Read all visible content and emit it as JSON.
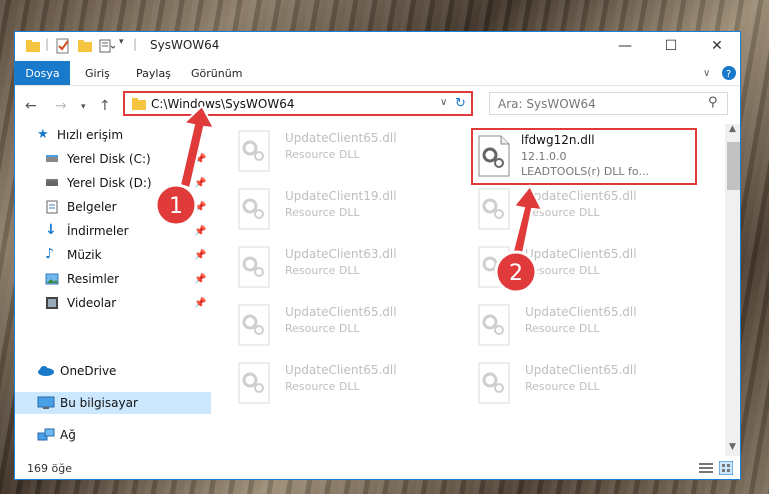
{
  "window": {
    "title": "SysWOW64",
    "controls": {
      "minimize": "—",
      "maximize": "☐",
      "close": "✕"
    }
  },
  "ribbon": {
    "file_tab": "Dosya",
    "tabs": [
      "Giriş",
      "Paylaş",
      "Görünüm"
    ]
  },
  "address": {
    "path": "C:\\Windows\\SysWOW64",
    "search_placeholder": "Ara: SysWOW64"
  },
  "nav": {
    "items": [
      {
        "label": "Hızlı erişim",
        "icon": "star-icon"
      },
      {
        "label": "Yerel Disk (C:)",
        "icon": "drive-icon"
      },
      {
        "label": "Yerel Disk (D:)",
        "icon": "drive-icon"
      },
      {
        "label": "Belgeler",
        "icon": "documents-icon"
      },
      {
        "label": "İndirmeler",
        "icon": "download-icon"
      },
      {
        "label": "Müzik",
        "icon": "music-icon"
      },
      {
        "label": "Resimler",
        "icon": "pictures-icon"
      },
      {
        "label": "Videolar",
        "icon": "videos-icon"
      },
      {
        "label": "OneDrive",
        "icon": "cloud-icon"
      },
      {
        "label": "Bu bilgisayar",
        "icon": "computer-icon"
      },
      {
        "label": "Ağ",
        "icon": "network-icon"
      }
    ]
  },
  "files": {
    "left": [
      {
        "name": "UpdateClient65.dll",
        "desc": "Resource DLL"
      },
      {
        "name": "UpdateClient19.dll",
        "desc": "Resource DLL"
      },
      {
        "name": "UpdateClient63.dll",
        "desc": "Resource DLL"
      },
      {
        "name": "UpdateClient65.dll",
        "desc": "Resource DLL"
      },
      {
        "name": "UpdateClient65.dll",
        "desc": "Resource DLL"
      }
    ],
    "right": [
      {
        "name": "UpdateClient65.dll",
        "desc": "Resource DLL"
      },
      {
        "name": "UpdateClient65.dll",
        "desc": "Resource DLL"
      },
      {
        "name": "UpdateClient65.dll",
        "desc": "Resource DLL"
      },
      {
        "name": "UpdateClient65.dll",
        "desc": "Resource DLL"
      }
    ],
    "highlighted": {
      "name": "lfdwg12n.dll",
      "version": "12.1.0.0",
      "desc": "LEADTOOLS(r) DLL fo..."
    }
  },
  "status": {
    "count": "169 öğe"
  },
  "annotations": {
    "badge1": "1",
    "badge2": "2",
    "color": "#e03a3a"
  }
}
